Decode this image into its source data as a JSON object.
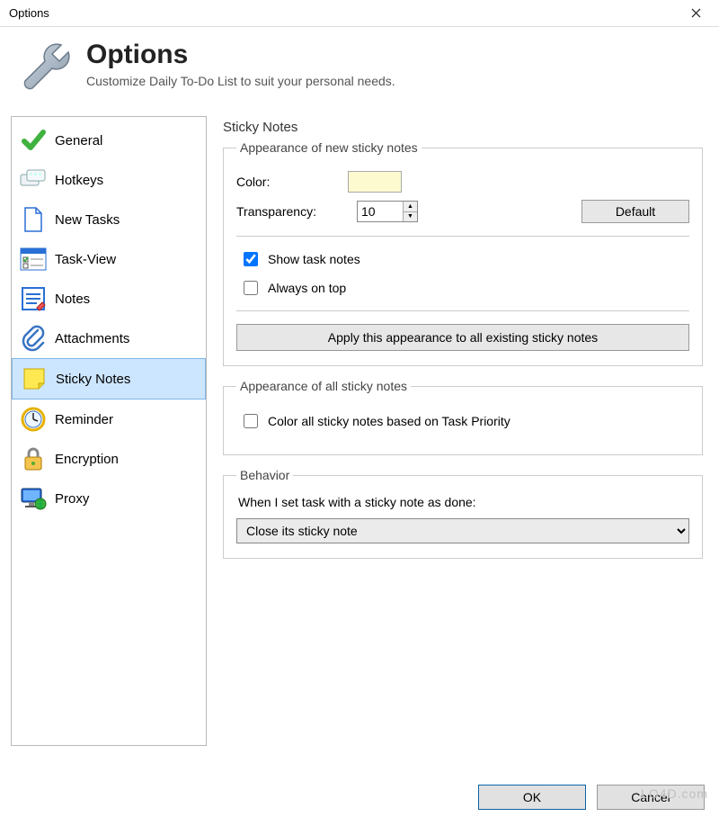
{
  "window": {
    "title": "Options"
  },
  "header": {
    "title": "Options",
    "subtitle": "Customize Daily To-Do List to suit your personal needs."
  },
  "sidebar": {
    "items": [
      {
        "label": "General"
      },
      {
        "label": "Hotkeys"
      },
      {
        "label": "New Tasks"
      },
      {
        "label": "Task-View"
      },
      {
        "label": "Notes"
      },
      {
        "label": "Attachments"
      },
      {
        "label": "Sticky Notes"
      },
      {
        "label": "Reminder"
      },
      {
        "label": "Encryption"
      },
      {
        "label": "Proxy"
      }
    ],
    "selected_index": 6
  },
  "panel": {
    "title": "Sticky Notes",
    "group_new": {
      "legend": "Appearance of new sticky notes",
      "color_label": "Color:",
      "color_value": "#fdfad0",
      "transparency_label": "Transparency:",
      "transparency_value": "10",
      "default_button": "Default",
      "show_task_notes": {
        "label": "Show task notes",
        "checked": true
      },
      "always_on_top": {
        "label": "Always on top",
        "checked": false
      },
      "apply_button": "Apply this appearance to all existing sticky notes"
    },
    "group_all": {
      "legend": "Appearance of all sticky notes",
      "color_by_priority": {
        "label": "Color all sticky notes based on Task Priority",
        "checked": false
      }
    },
    "group_behavior": {
      "legend": "Behavior",
      "prompt": "When I set task with a sticky note as done:",
      "selected": "Close its sticky note"
    }
  },
  "footer": {
    "ok": "OK",
    "cancel": "Cancel"
  },
  "watermark": "LO4D.com"
}
